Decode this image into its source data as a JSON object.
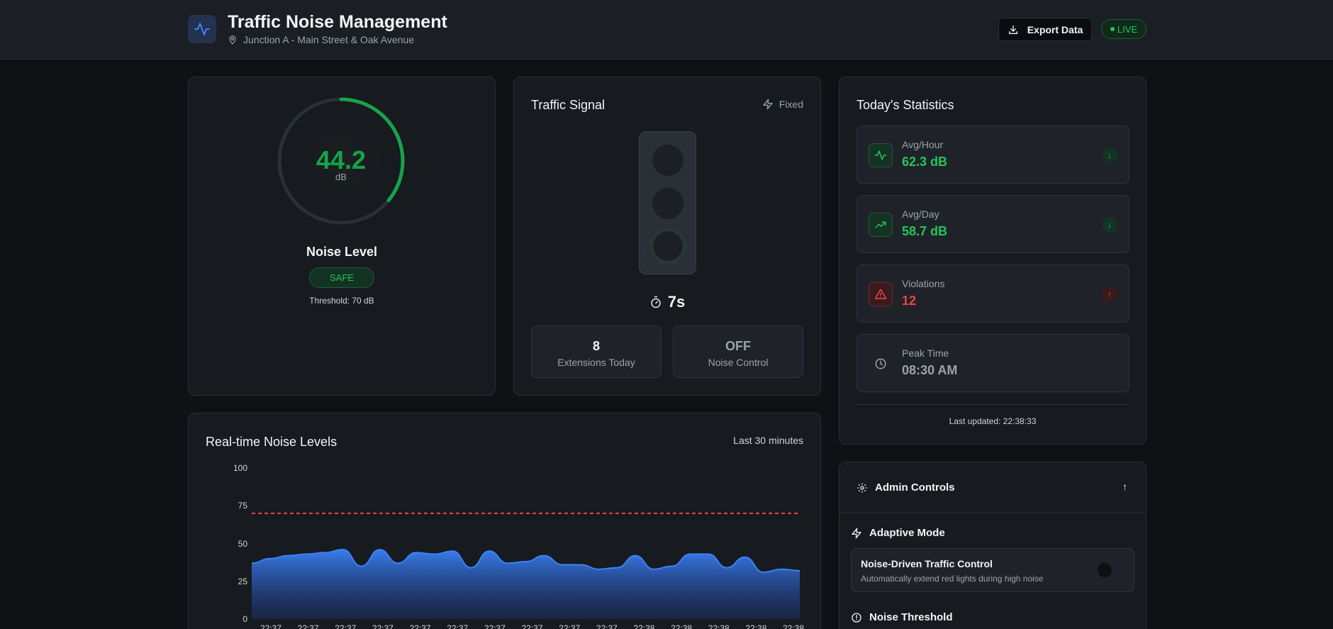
{
  "header": {
    "title": "Traffic Noise Management",
    "location": "Junction A - Main Street & Oak Avenue",
    "export_label": "Export Data",
    "live_label": "LIVE",
    "logo_icon": "activity-icon"
  },
  "noise": {
    "value": "44.2",
    "unit": "dB",
    "gauge_fraction": 0.36,
    "label": "Noise Level",
    "status": "SAFE",
    "threshold": "Threshold: 70 dB",
    "color": "#16a34a"
  },
  "signal": {
    "title": "Traffic Signal",
    "mode": "Fixed",
    "active_light": "green",
    "timer": "7s",
    "extensions_value": "8",
    "extensions_label": "Extensions Today",
    "noise_control_value": "OFF",
    "noise_control_label": "Noise Control"
  },
  "stats": {
    "title": "Today's Statistics",
    "items": [
      {
        "label": "Avg/Hour",
        "value": "62.3 dB",
        "icon": "activity-icon",
        "trend": "↓",
        "color": "#22c55e"
      },
      {
        "label": "Avg/Day",
        "value": "58.7 dB",
        "icon": "trending-up-icon",
        "trend": "↓",
        "color": "#22c55e"
      },
      {
        "label": "Violations",
        "value": "12",
        "icon": "alert-triangle-icon",
        "trend": "↑",
        "color": "#ef4444"
      },
      {
        "label": "Peak Time",
        "value": "08:30 AM",
        "icon": "clock-icon",
        "trend": "",
        "color": "#9ca3af"
      }
    ],
    "last_updated": "Last updated: 22:38:33"
  },
  "chart_section": {
    "title": "Real-time Noise Levels",
    "range": "Last 30 minutes"
  },
  "chart_data": {
    "type": "area",
    "title": "Real-time Noise Levels",
    "ylim": [
      0,
      100
    ],
    "yticks": [
      "100",
      "75",
      "50",
      "25",
      "0"
    ],
    "threshold": 70,
    "x": [
      "22:37",
      "22:37",
      "22:37",
      "22:37",
      "22:37",
      "22:37",
      "22:37",
      "22:37",
      "22:37",
      "22:37",
      "22:38",
      "22:38",
      "22:38",
      "22:38",
      "22:38"
    ],
    "series": [
      {
        "values": [
          37,
          40,
          42,
          43,
          44,
          46,
          35,
          46,
          37,
          44,
          43,
          45,
          34,
          45,
          37,
          38,
          42,
          36,
          36,
          33,
          34,
          42,
          33,
          35,
          43,
          43,
          34,
          41,
          31,
          33,
          32
        ]
      }
    ],
    "grid": false
  },
  "admin": {
    "title": "Admin Controls",
    "toggle_icon": "↑",
    "adaptive_title": "Adaptive Mode",
    "setting_title": "Noise-Driven Traffic Control",
    "setting_desc": "Automatically extend red lights during high noise",
    "threshold_title": "Noise Threshold"
  }
}
